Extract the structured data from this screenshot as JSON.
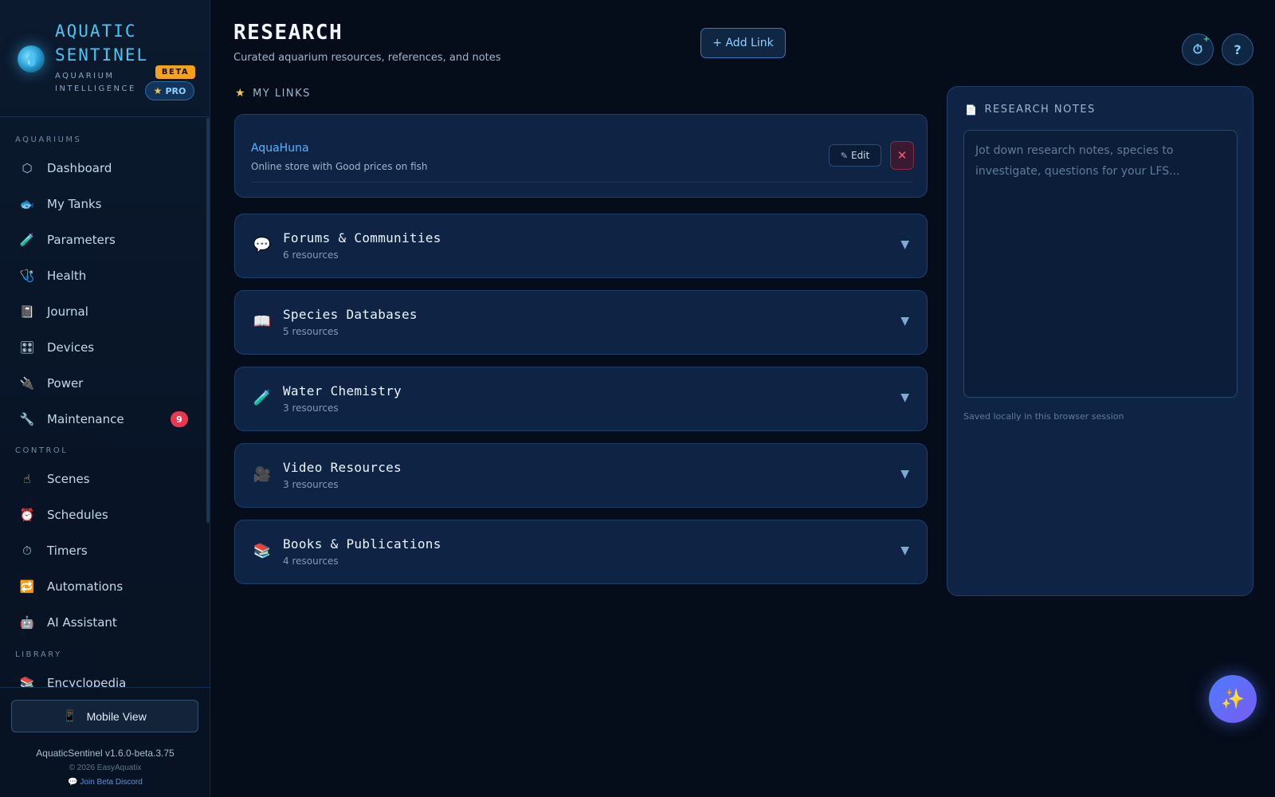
{
  "brand": {
    "title": "AQUATIC SENTINEL",
    "subtitle": "AQUARIUM INTELLIGENCE",
    "beta": "BETA",
    "pro": "PRO"
  },
  "nav": {
    "sections": [
      "AQUARIUMS",
      "CONTROL",
      "LIBRARY"
    ],
    "aquariums": [
      {
        "label": "Dashboard",
        "icon": "hexagon-icon",
        "glyph": "⬡"
      },
      {
        "label": "My Tanks",
        "icon": "fish-icon",
        "glyph": "🐟"
      },
      {
        "label": "Parameters",
        "icon": "test-tube-icon",
        "glyph": "🧪"
      },
      {
        "label": "Health",
        "icon": "stethoscope-icon",
        "glyph": "🩺"
      },
      {
        "label": "Journal",
        "icon": "notebook-icon",
        "glyph": "📓"
      },
      {
        "label": "Devices",
        "icon": "control-knobs-icon",
        "glyph": "🎛"
      },
      {
        "label": "Power",
        "icon": "plug-icon",
        "glyph": "🔌"
      },
      {
        "label": "Maintenance",
        "icon": "wrench-icon",
        "glyph": "🔧",
        "badge": "9"
      }
    ],
    "control": [
      {
        "label": "Scenes",
        "icon": "pointing-hand-icon",
        "glyph": "☝"
      },
      {
        "label": "Schedules",
        "icon": "alarm-clock-icon",
        "glyph": "⏰"
      },
      {
        "label": "Timers",
        "icon": "stopwatch-icon",
        "glyph": "⏱"
      },
      {
        "label": "Automations",
        "icon": "repeat-icon",
        "glyph": "🔁"
      },
      {
        "label": "AI Assistant",
        "icon": "robot-icon",
        "glyph": "🤖"
      }
    ],
    "library": [
      {
        "label": "Encyclopedia",
        "icon": "books-icon",
        "glyph": "📚"
      }
    ]
  },
  "footer": {
    "mobile_view": "Mobile View",
    "version": "AquaticSentinel v1.6.0-beta.3.75",
    "copyright": "© 2026 EasyAquatix",
    "discord": "Join Beta Discord"
  },
  "header": {
    "title": "RESEARCH",
    "subtitle": "Curated aquarium resources, references, and notes",
    "add_link": "+ Add Link",
    "help": "?"
  },
  "my_links": {
    "label": "MY LINKS",
    "items": [
      {
        "name": "AquaHuna",
        "description": "Online store with Good prices on fish",
        "edit_label": "Edit"
      }
    ]
  },
  "categories": [
    {
      "name": "Forums & Communities",
      "count": "6 resources",
      "icon": "speech-bubble-icon",
      "glyph": "💬"
    },
    {
      "name": "Species Databases",
      "count": "5 resources",
      "icon": "open-book-icon",
      "glyph": "📖"
    },
    {
      "name": "Water Chemistry",
      "count": "3 resources",
      "icon": "test-tube-icon",
      "glyph": "🧪"
    },
    {
      "name": "Video Resources",
      "count": "3 resources",
      "icon": "movie-camera-icon",
      "glyph": "🎥"
    },
    {
      "name": "Books & Publications",
      "count": "4 resources",
      "icon": "books-icon",
      "glyph": "📚"
    }
  ],
  "notes": {
    "title": "RESEARCH NOTES",
    "placeholder": "Jot down research notes, species to investigate, questions for your LFS...",
    "footer": "Saved locally in this browser session"
  },
  "colors": {
    "accent": "#49c6f2",
    "link": "#58b6ff",
    "beta": "#f4a11c",
    "danger": "#e8384f",
    "card": "#0f2445"
  }
}
